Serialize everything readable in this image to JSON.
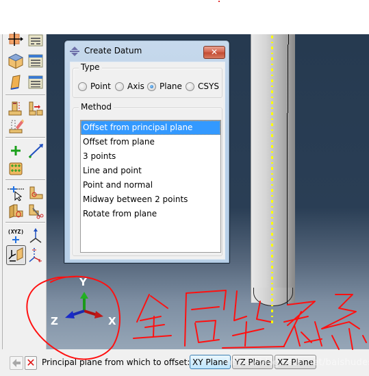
{
  "dialog": {
    "title": "Create Datum",
    "close_label": "✕",
    "type_group": {
      "label": "Type",
      "options": [
        {
          "label": "Point",
          "selected": false
        },
        {
          "label": "Axis",
          "selected": false
        },
        {
          "label": "Plane",
          "selected": true
        },
        {
          "label": "CSYS",
          "selected": false
        }
      ]
    },
    "method_group": {
      "label": "Method",
      "items": [
        {
          "label": "Offset from principal plane",
          "selected": true
        },
        {
          "label": "Offset from plane",
          "selected": false
        },
        {
          "label": "3 points",
          "selected": false
        },
        {
          "label": "Line and point",
          "selected": false
        },
        {
          "label": "Point and normal",
          "selected": false
        },
        {
          "label": "Midway between 2 points",
          "selected": false
        },
        {
          "label": "Rotate from plane",
          "selected": false
        }
      ]
    }
  },
  "prompt": {
    "text": "Principal plane from which to offset:",
    "buttons": [
      "XY Plane",
      "YZ Plane",
      "XZ Plane"
    ],
    "watermark": "https://blog.csdn.net/baishudesenlin"
  },
  "triad": {
    "x": "X",
    "y": "Y",
    "z": "Z"
  },
  "toolbox": {
    "icons": [
      "partition-face-icon",
      "query-tools-icon",
      "create-part-icon",
      "part-manager-icon",
      "create-section-icon",
      "section-manager-icon",
      "extrude-cut-icon",
      "shell-extrude-icon",
      "edit-feature-icon",
      "create-point-icon",
      "create-line-icon",
      "mesh-seeds-icon",
      "partition-edge-icon",
      "round-fillet-icon",
      "partition-cell-icon",
      "cut-tool-icon",
      "datum-point-icon",
      "datum-axis-icon",
      "datum-plane-icon",
      "datum-csys-icon"
    ]
  },
  "annotation": {
    "text": "全局坐标系",
    "color": "#ff0000"
  },
  "colors": {
    "viewport_top": "#263a50",
    "viewport_bottom": "#96a6b7",
    "selection": "#3399ff",
    "datum_axis": "#ffff00"
  }
}
